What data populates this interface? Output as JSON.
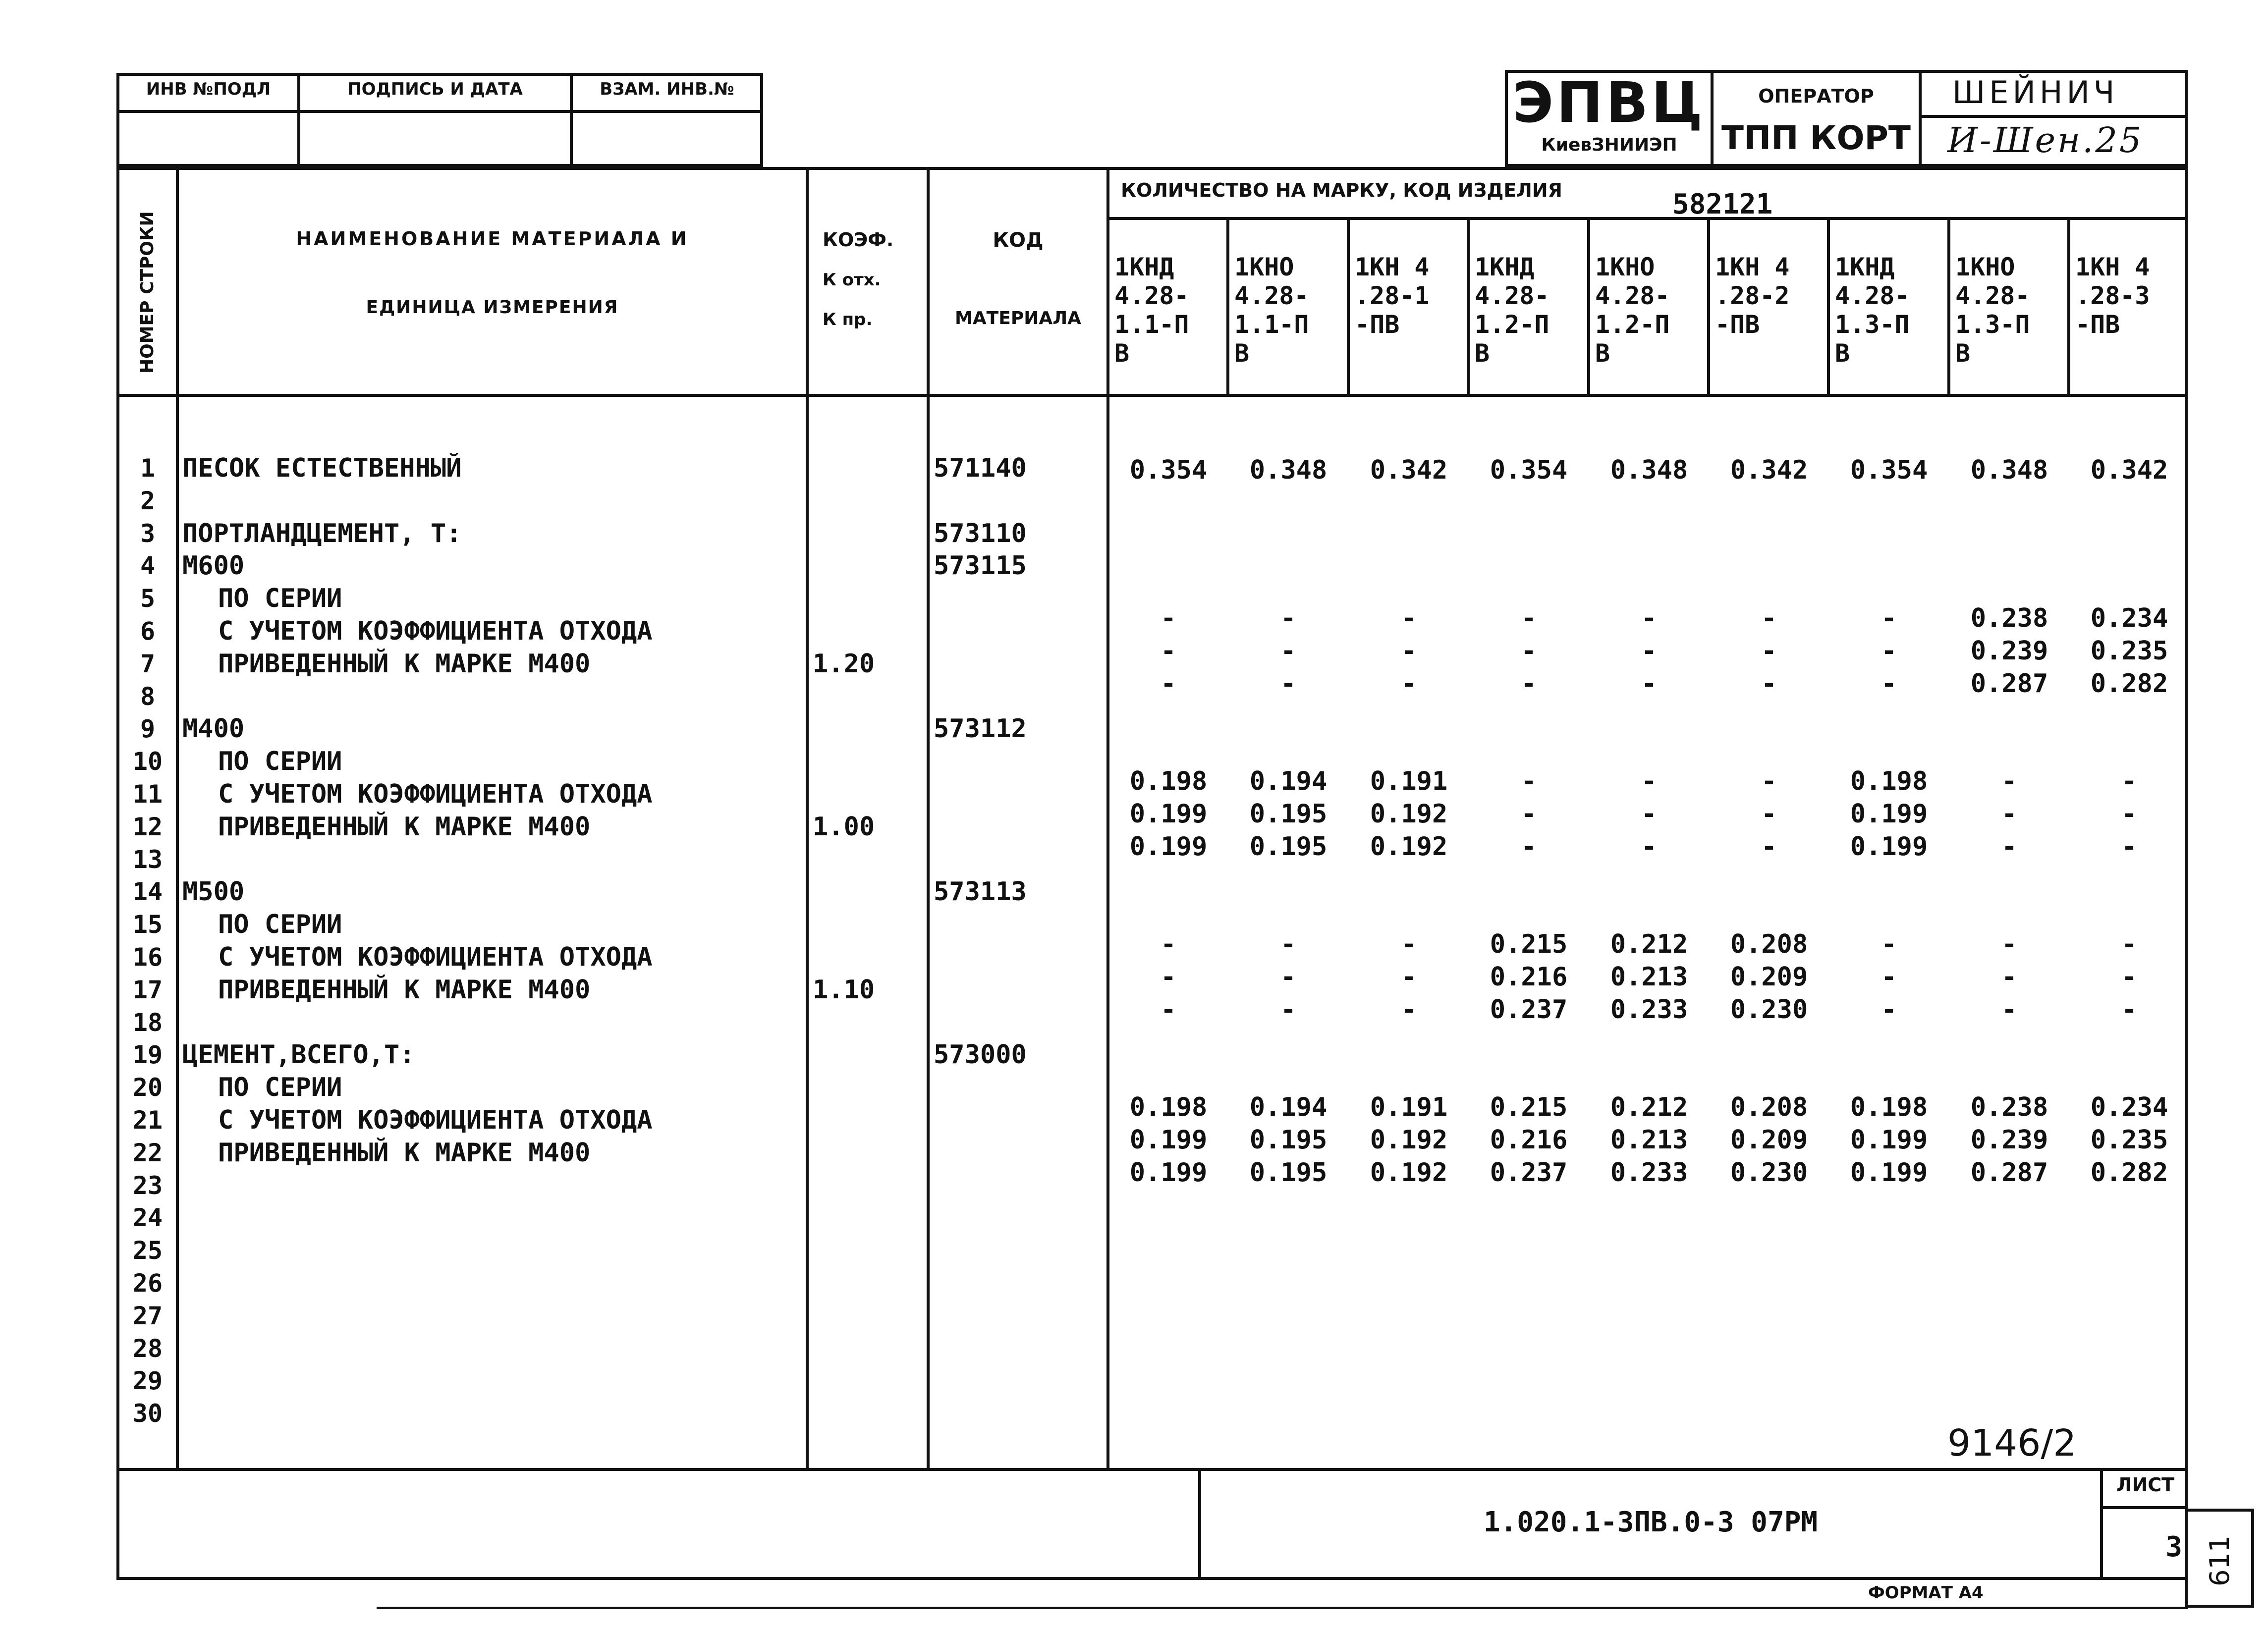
{
  "top_left_stamp": {
    "labels": [
      "ИНВ №ПОДЛ",
      "ПОДПИСЬ И ДАТА",
      "ВЗАМ. ИНВ.№"
    ],
    "values": [
      "",
      "",
      ""
    ]
  },
  "top_right_stamp": {
    "org_title": "ЭПВЦ",
    "org_subtitle": "КиевЗНИИЭП",
    "operator_label": "ОПЕРАТОР",
    "operator_dept": "ТПП КОРТ",
    "operator_name": "ШЕЙНИЧ",
    "operator_signature": "И-Шен.25"
  },
  "table": {
    "headers": {
      "row_number": "НОМЕР СТРОКИ",
      "name_line1": "НАИМЕНОВАНИЕ МАТЕРИАЛА И",
      "name_line2": "ЕДИНИЦА ИЗМЕРЕНИЯ",
      "coef_line1": "КОЭФ.",
      "coef_line2": "К отх.",
      "coef_line3": "К пр.",
      "code_line1": "КОД",
      "code_line2": "МАТЕРИАЛА",
      "quantity_title": "КОЛИЧЕСТВО НА МАРКУ, КОД ИЗДЕЛИЯ",
      "product_code": "582121"
    },
    "mark_columns": [
      "1КНД\n4.28-\n1.1-П\nВ",
      "1КНО\n4.28-\n1.1-П\nВ",
      "1КН 4\n.28-1\n-ПВ",
      "1КНД\n4.28-\n1.2-П\nВ",
      "1КНО\n4.28-\n1.2-П\nВ",
      "1КН 4\n.28-2\n-ПВ",
      "1КНД\n4.28-\n1.3-П\nВ",
      "1КНО\n4.28-\n1.3-П\nВ",
      "1КН 4\n.28-3\n-ПВ"
    ],
    "row_numbers": [
      "1",
      "2",
      "3",
      "4",
      "5",
      "6",
      "7",
      "8",
      "9",
      "10",
      "11",
      "12",
      "13",
      "14",
      "15",
      "16",
      "17",
      "18",
      "19",
      "20",
      "21",
      "22",
      "23",
      "24",
      "25",
      "26",
      "27",
      "28",
      "29",
      "30"
    ],
    "rows": [
      {
        "n": 1,
        "name": "ПЕСОК ЕСТЕСТВЕННЫЙ",
        "indent": false,
        "coef": "",
        "code": "571140",
        "values": [
          "0.354",
          "0.348",
          "0.342",
          "0.354",
          "0.348",
          "0.342",
          "0.354",
          "0.348",
          "0.342"
        ]
      },
      {
        "n": 3,
        "name": "ПОРТЛАНДЦЕМЕНТ, Т:",
        "indent": false,
        "coef": "",
        "code": "573110",
        "values": []
      },
      {
        "n": 4,
        "name": "М600",
        "indent": false,
        "coef": "",
        "code": "573115",
        "values": []
      },
      {
        "n": 5,
        "name": "ПО СЕРИИ",
        "indent": true,
        "coef": "",
        "code": "",
        "values": [
          "-",
          "-",
          "-",
          "-",
          "-",
          "-",
          "-",
          "0.238",
          "0.234"
        ]
      },
      {
        "n": 6,
        "name": "С УЧЕТОМ КОЭФФИЦИЕНТА ОТХОДА",
        "indent": true,
        "coef": "",
        "code": "",
        "values": [
          "-",
          "-",
          "-",
          "-",
          "-",
          "-",
          "-",
          "0.239",
          "0.235"
        ]
      },
      {
        "n": 7,
        "name": "ПРИВЕДЕННЫЙ К МАРКЕ М400",
        "indent": true,
        "coef": "1.20",
        "code": "",
        "values": [
          "-",
          "-",
          "-",
          "-",
          "-",
          "-",
          "-",
          "0.287",
          "0.282"
        ]
      },
      {
        "n": 9,
        "name": "М400",
        "indent": false,
        "coef": "",
        "code": "573112",
        "values": []
      },
      {
        "n": 10,
        "name": "ПО СЕРИИ",
        "indent": true,
        "coef": "",
        "code": "",
        "values": [
          "0.198",
          "0.194",
          "0.191",
          "-",
          "-",
          "-",
          "0.198",
          "-",
          "-"
        ]
      },
      {
        "n": 11,
        "name": "С УЧЕТОМ КОЭФФИЦИЕНТА ОТХОДА",
        "indent": true,
        "coef": "",
        "code": "",
        "values": [
          "0.199",
          "0.195",
          "0.192",
          "-",
          "-",
          "-",
          "0.199",
          "-",
          "-"
        ]
      },
      {
        "n": 12,
        "name": "ПРИВЕДЕННЫЙ К МАРКЕ М400",
        "indent": true,
        "coef": "1.00",
        "code": "",
        "values": [
          "0.199",
          "0.195",
          "0.192",
          "-",
          "-",
          "-",
          "0.199",
          "-",
          "-"
        ]
      },
      {
        "n": 14,
        "name": "М500",
        "indent": false,
        "coef": "",
        "code": "573113",
        "values": []
      },
      {
        "n": 15,
        "name": "ПО СЕРИИ",
        "indent": true,
        "coef": "",
        "code": "",
        "values": [
          "-",
          "-",
          "-",
          "0.215",
          "0.212",
          "0.208",
          "-",
          "-",
          "-"
        ]
      },
      {
        "n": 16,
        "name": "С УЧЕТОМ КОЭФФИЦИЕНТА ОТХОДА",
        "indent": true,
        "coef": "",
        "code": "",
        "values": [
          "-",
          "-",
          "-",
          "0.216",
          "0.213",
          "0.209",
          "-",
          "-",
          "-"
        ]
      },
      {
        "n": 17,
        "name": "ПРИВЕДЕННЫЙ К МАРКЕ М400",
        "indent": true,
        "coef": "1.10",
        "code": "",
        "values": [
          "-",
          "-",
          "-",
          "0.237",
          "0.233",
          "0.230",
          "-",
          "-",
          "-"
        ]
      },
      {
        "n": 19,
        "name": "ЦЕМЕНТ,ВСЕГО,Т:",
        "indent": false,
        "coef": "",
        "code": "573000",
        "values": []
      },
      {
        "n": 20,
        "name": "ПО СЕРИИ",
        "indent": true,
        "coef": "",
        "code": "",
        "values": [
          "0.198",
          "0.194",
          "0.191",
          "0.215",
          "0.212",
          "0.208",
          "0.198",
          "0.238",
          "0.234"
        ]
      },
      {
        "n": 21,
        "name": "С УЧЕТОМ КОЭФФИЦИЕНТА ОТХОДА",
        "indent": true,
        "coef": "",
        "code": "",
        "values": [
          "0.199",
          "0.195",
          "0.192",
          "0.216",
          "0.213",
          "0.209",
          "0.199",
          "0.239",
          "0.235"
        ]
      },
      {
        "n": 22,
        "name": "ПРИВЕДЕННЫЙ К МАРКЕ М400",
        "indent": true,
        "coef": "",
        "code": "",
        "values": [
          "0.199",
          "0.195",
          "0.192",
          "0.237",
          "0.233",
          "0.230",
          "0.199",
          "0.287",
          "0.282"
        ]
      }
    ]
  },
  "footer": {
    "handwritten_number": "9146/2",
    "document_code": "1.020.1-3ПВ.0-3 07РМ",
    "sheet_label": "ЛИСТ",
    "sheet_number": "3",
    "format_label": "ФОРМАТ А4",
    "side_number": "611"
  }
}
